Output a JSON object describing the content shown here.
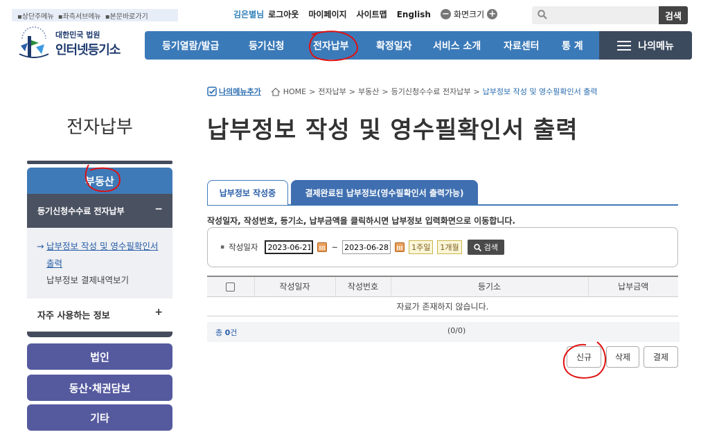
{
  "skip_links": [
    "상단주메뉴",
    "좌측서브메뉴",
    "본문바로가기"
  ],
  "util": {
    "user": "김은별님",
    "logout": "로그아웃",
    "mypage": "마이페이지",
    "sitemap": "사이트맵",
    "english": "English",
    "zoom_minus": "−",
    "zoom_label": "화면크기",
    "zoom_plus": "+"
  },
  "search": {
    "placeholder": "",
    "button": "검색"
  },
  "logo": {
    "line1": "대한민국 법원",
    "line2": "인터넷등기소"
  },
  "gnb": {
    "items": [
      "등기열람/발급",
      "등기신청",
      "전자납부",
      "확정일자",
      "서비스 소개",
      "자료센터",
      "통 계"
    ],
    "mymenu": "나의메뉴"
  },
  "breadcrumb": {
    "add": "나의메뉴추가",
    "home": "HOME",
    "items": [
      "전자납부",
      "부동산",
      "등기신청수수료 전자납부"
    ],
    "current": "납부정보 작성 및 영수필확인서 출력",
    "sep": ">"
  },
  "page_title": "납부정보 작성 및 영수필확인서 출력",
  "sidebar": {
    "title": "전자납부",
    "active": "부동산",
    "sub": "등기신청수수료 전자납부",
    "sub_toggle": "−",
    "links": [
      "납부정보 작성 및 영수필확인서 출력",
      "납부정보 결제내역보기"
    ],
    "favorites": "자주 사용하는 정보",
    "fav_toggle": "+",
    "buttons": [
      "법인",
      "동산·채권담보",
      "기타"
    ]
  },
  "tabs": [
    "납부정보 작성중",
    "결제완료된 납부정보(영수필확인서 출력가능)"
  ],
  "guide": "작성일자, 작성번호, 등기소, 납부금액을 클릭하시면 납부정보 입력화면으로 이동합니다.",
  "filter": {
    "bullet": "▪",
    "label": "작성일자",
    "from": "2023-06-21",
    "tilde": "~",
    "to": "2023-06-28",
    "week": "1주일",
    "month": "1개월",
    "search": "검색"
  },
  "table": {
    "headers": [
      "",
      "작성일자",
      "작성번호",
      "등기소",
      "납부금액"
    ],
    "empty": "자료가 존재하지 않습니다."
  },
  "pager": {
    "total_prefix": "총 ",
    "total_count": "0",
    "total_suffix": "건",
    "page": "(0/0)"
  },
  "actions": [
    "신규",
    "삭제",
    "결제"
  ]
}
